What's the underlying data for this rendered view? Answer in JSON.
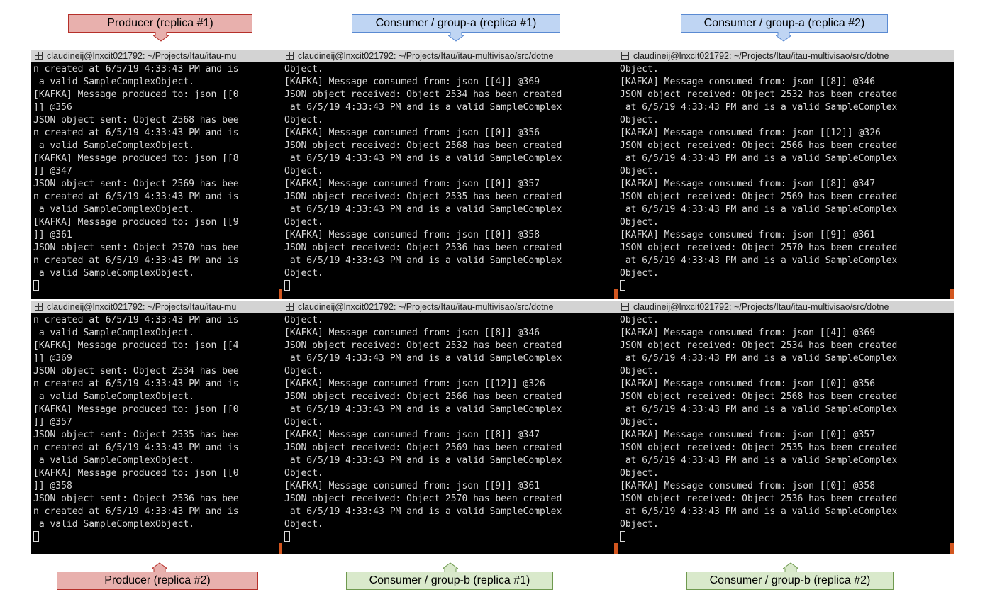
{
  "callouts": {
    "top_left": "Producer (replica #1)",
    "top_mid": "Consumer / group-a  (replica #1)",
    "top_right": "Consumer / group-a  (replica #2)",
    "bottom_left": "Producer (replica #2)",
    "bottom_mid": "Consumer / group-b (replica #1)",
    "bottom_right": "Consumer / group-b (replica #2)"
  },
  "colors": {
    "producer": "#e8b0ad",
    "group_a": "#bfd5f3",
    "group_b": "#d9e9cb",
    "terminal_bg": "#000000",
    "terminal_text": "#d9d9d9"
  },
  "terminals": {
    "tl": {
      "title": "claudineij@lnxcit021792: ~/Projects/Itau/itau-mu",
      "lines": [
        "n created at 6/5/19 4:33:43 PM and is",
        " a valid SampleComplexObject.",
        "[KAFKA] Message produced to: json [[0",
        "]] @356",
        "JSON object sent: Object 2568 has bee",
        "n created at 6/5/19 4:33:43 PM and is",
        " a valid SampleComplexObject.",
        "[KAFKA] Message produced to: json [[8",
        "]] @347",
        "JSON object sent: Object 2569 has bee",
        "n created at 6/5/19 4:33:43 PM and is",
        " a valid SampleComplexObject.",
        "[KAFKA] Message produced to: json [[9",
        "]] @361",
        "JSON object sent: Object 2570 has bee",
        "n created at 6/5/19 4:33:43 PM and is",
        " a valid SampleComplexObject."
      ]
    },
    "tm": {
      "title": "claudineij@lnxcit021792: ~/Projects/Itau/itau-multivisao/src/dotne",
      "lines": [
        "Object.",
        "[KAFKA] Message consumed from: json [[4]] @369",
        "JSON object received: Object 2534 has been created",
        " at 6/5/19 4:33:43 PM and is a valid SampleComplex",
        "Object.",
        "[KAFKA] Message consumed from: json [[0]] @356",
        "JSON object received: Object 2568 has been created",
        " at 6/5/19 4:33:43 PM and is a valid SampleComplex",
        "Object.",
        "[KAFKA] Message consumed from: json [[0]] @357",
        "JSON object received: Object 2535 has been created",
        " at 6/5/19 4:33:43 PM and is a valid SampleComplex",
        "Object.",
        "[KAFKA] Message consumed from: json [[0]] @358",
        "JSON object received: Object 2536 has been created",
        " at 6/5/19 4:33:43 PM and is a valid SampleComplex",
        "Object."
      ]
    },
    "tr": {
      "title": "claudineij@lnxcit021792: ~/Projects/Itau/itau-multivisao/src/dotne",
      "lines": [
        "Object.",
        "[KAFKA] Message consumed from: json [[8]] @346",
        "JSON object received: Object 2532 has been created",
        " at 6/5/19 4:33:43 PM and is a valid SampleComplex",
        "Object.",
        "[KAFKA] Message consumed from: json [[12]] @326",
        "JSON object received: Object 2566 has been created",
        " at 6/5/19 4:33:43 PM and is a valid SampleComplex",
        "Object.",
        "[KAFKA] Message consumed from: json [[8]] @347",
        "JSON object received: Object 2569 has been created",
        " at 6/5/19 4:33:43 PM and is a valid SampleComplex",
        "Object.",
        "[KAFKA] Message consumed from: json [[9]] @361",
        "JSON object received: Object 2570 has been created",
        " at 6/5/19 4:33:43 PM and is a valid SampleComplex",
        "Object."
      ]
    },
    "bl": {
      "title": "claudineij@lnxcit021792: ~/Projects/Itau/itau-mu",
      "lines": [
        "n created at 6/5/19 4:33:43 PM and is",
        " a valid SampleComplexObject.",
        "[KAFKA] Message produced to: json [[4",
        "]] @369",
        "JSON object sent: Object 2534 has bee",
        "n created at 6/5/19 4:33:43 PM and is",
        " a valid SampleComplexObject.",
        "[KAFKA] Message produced to: json [[0",
        "]] @357",
        "JSON object sent: Object 2535 has bee",
        "n created at 6/5/19 4:33:43 PM and is",
        " a valid SampleComplexObject.",
        "[KAFKA] Message produced to: json [[0",
        "]] @358",
        "JSON object sent: Object 2536 has bee",
        "n created at 6/5/19 4:33:43 PM and is",
        " a valid SampleComplexObject."
      ]
    },
    "bm": {
      "title": "claudineij@lnxcit021792: ~/Projects/Itau/itau-multivisao/src/dotne",
      "lines": [
        "Object.",
        "[KAFKA] Message consumed from: json [[8]] @346",
        "JSON object received: Object 2532 has been created",
        " at 6/5/19 4:33:43 PM and is a valid SampleComplex",
        "Object.",
        "[KAFKA] Message consumed from: json [[12]] @326",
        "JSON object received: Object 2566 has been created",
        " at 6/5/19 4:33:43 PM and is a valid SampleComplex",
        "Object.",
        "[KAFKA] Message consumed from: json [[8]] @347",
        "JSON object received: Object 2569 has been created",
        " at 6/5/19 4:33:43 PM and is a valid SampleComplex",
        "Object.",
        "[KAFKA] Message consumed from: json [[9]] @361",
        "JSON object received: Object 2570 has been created",
        " at 6/5/19 4:33:43 PM and is a valid SampleComplex",
        "Object."
      ]
    },
    "br": {
      "title": "claudineij@lnxcit021792: ~/Projects/Itau/itau-multivisao/src/dotne",
      "lines": [
        "Object.",
        "[KAFKA] Message consumed from: json [[4]] @369",
        "JSON object received: Object 2534 has been created",
        " at 6/5/19 4:33:43 PM and is a valid SampleComplex",
        "Object.",
        "[KAFKA] Message consumed from: json [[0]] @356",
        "JSON object received: Object 2568 has been created",
        " at 6/5/19 4:33:43 PM and is a valid SampleComplex",
        "Object.",
        "[KAFKA] Message consumed from: json [[0]] @357",
        "JSON object received: Object 2535 has been created",
        " at 6/5/19 4:33:43 PM and is a valid SampleComplex",
        "Object.",
        "[KAFKA] Message consumed from: json [[0]] @358",
        "JSON object received: Object 2536 has been created",
        " at 6/5/19 4:33:43 PM and is a valid SampleComplex",
        "Object."
      ]
    }
  }
}
